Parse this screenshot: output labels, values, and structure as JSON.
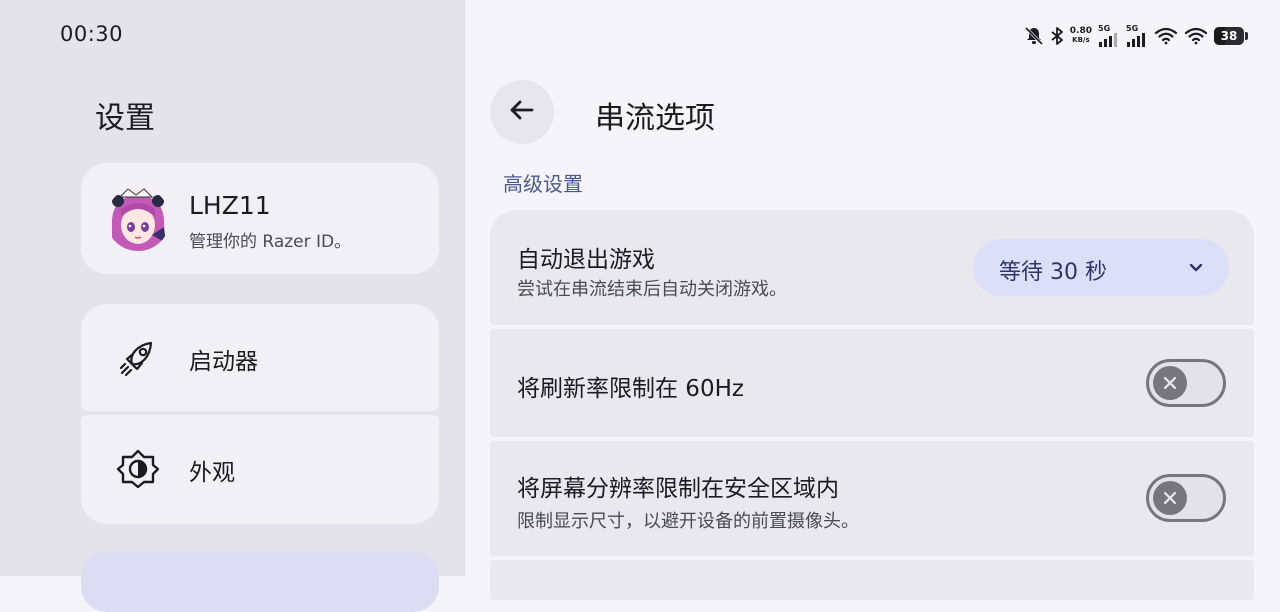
{
  "status_bar": {
    "time": "00:30",
    "net_speed_value": "0.80",
    "net_speed_unit": "KB/s",
    "sim1_label": "5G",
    "sim2_label": "5G",
    "battery_level": "38",
    "icons": [
      "bell-off-icon",
      "bluetooth-icon",
      "signal-icon",
      "signal-icon",
      "wifi-icon",
      "wifi-icon",
      "battery-icon"
    ]
  },
  "sidebar": {
    "title": "设置",
    "profile": {
      "name": "LHZ11",
      "subtitle": "管理你的 Razer ID。"
    },
    "items": [
      {
        "label": "启动器",
        "icon": "rocket-icon"
      },
      {
        "label": "外观",
        "icon": "brightness-icon"
      }
    ]
  },
  "main": {
    "title": "串流选项",
    "back_icon": "arrow-left-icon",
    "section": "高级设置",
    "settings": [
      {
        "title": "自动退出游戏",
        "subtitle": "尝试在串流结束后自动关闭游戏。",
        "control": "dropdown",
        "value": "等待 30 秒"
      },
      {
        "title": "将刷新率限制在 60Hz",
        "control": "toggle",
        "enabled": false
      },
      {
        "title": "将屏幕分辨率限制在安全区域内",
        "subtitle": "限制显示尺寸，以避开设备的前置摄像头。",
        "control": "toggle",
        "enabled": false
      }
    ]
  },
  "colors": {
    "sidebar_bg": "#e4e3ec",
    "main_bg": "#f5f4fa",
    "card_bg": "#f1f0f7",
    "row_bg": "#e9e8ef",
    "dropdown_bg": "#dcdff8",
    "section_accent": "#4c5a8a",
    "toggle_off": "#77767f"
  }
}
